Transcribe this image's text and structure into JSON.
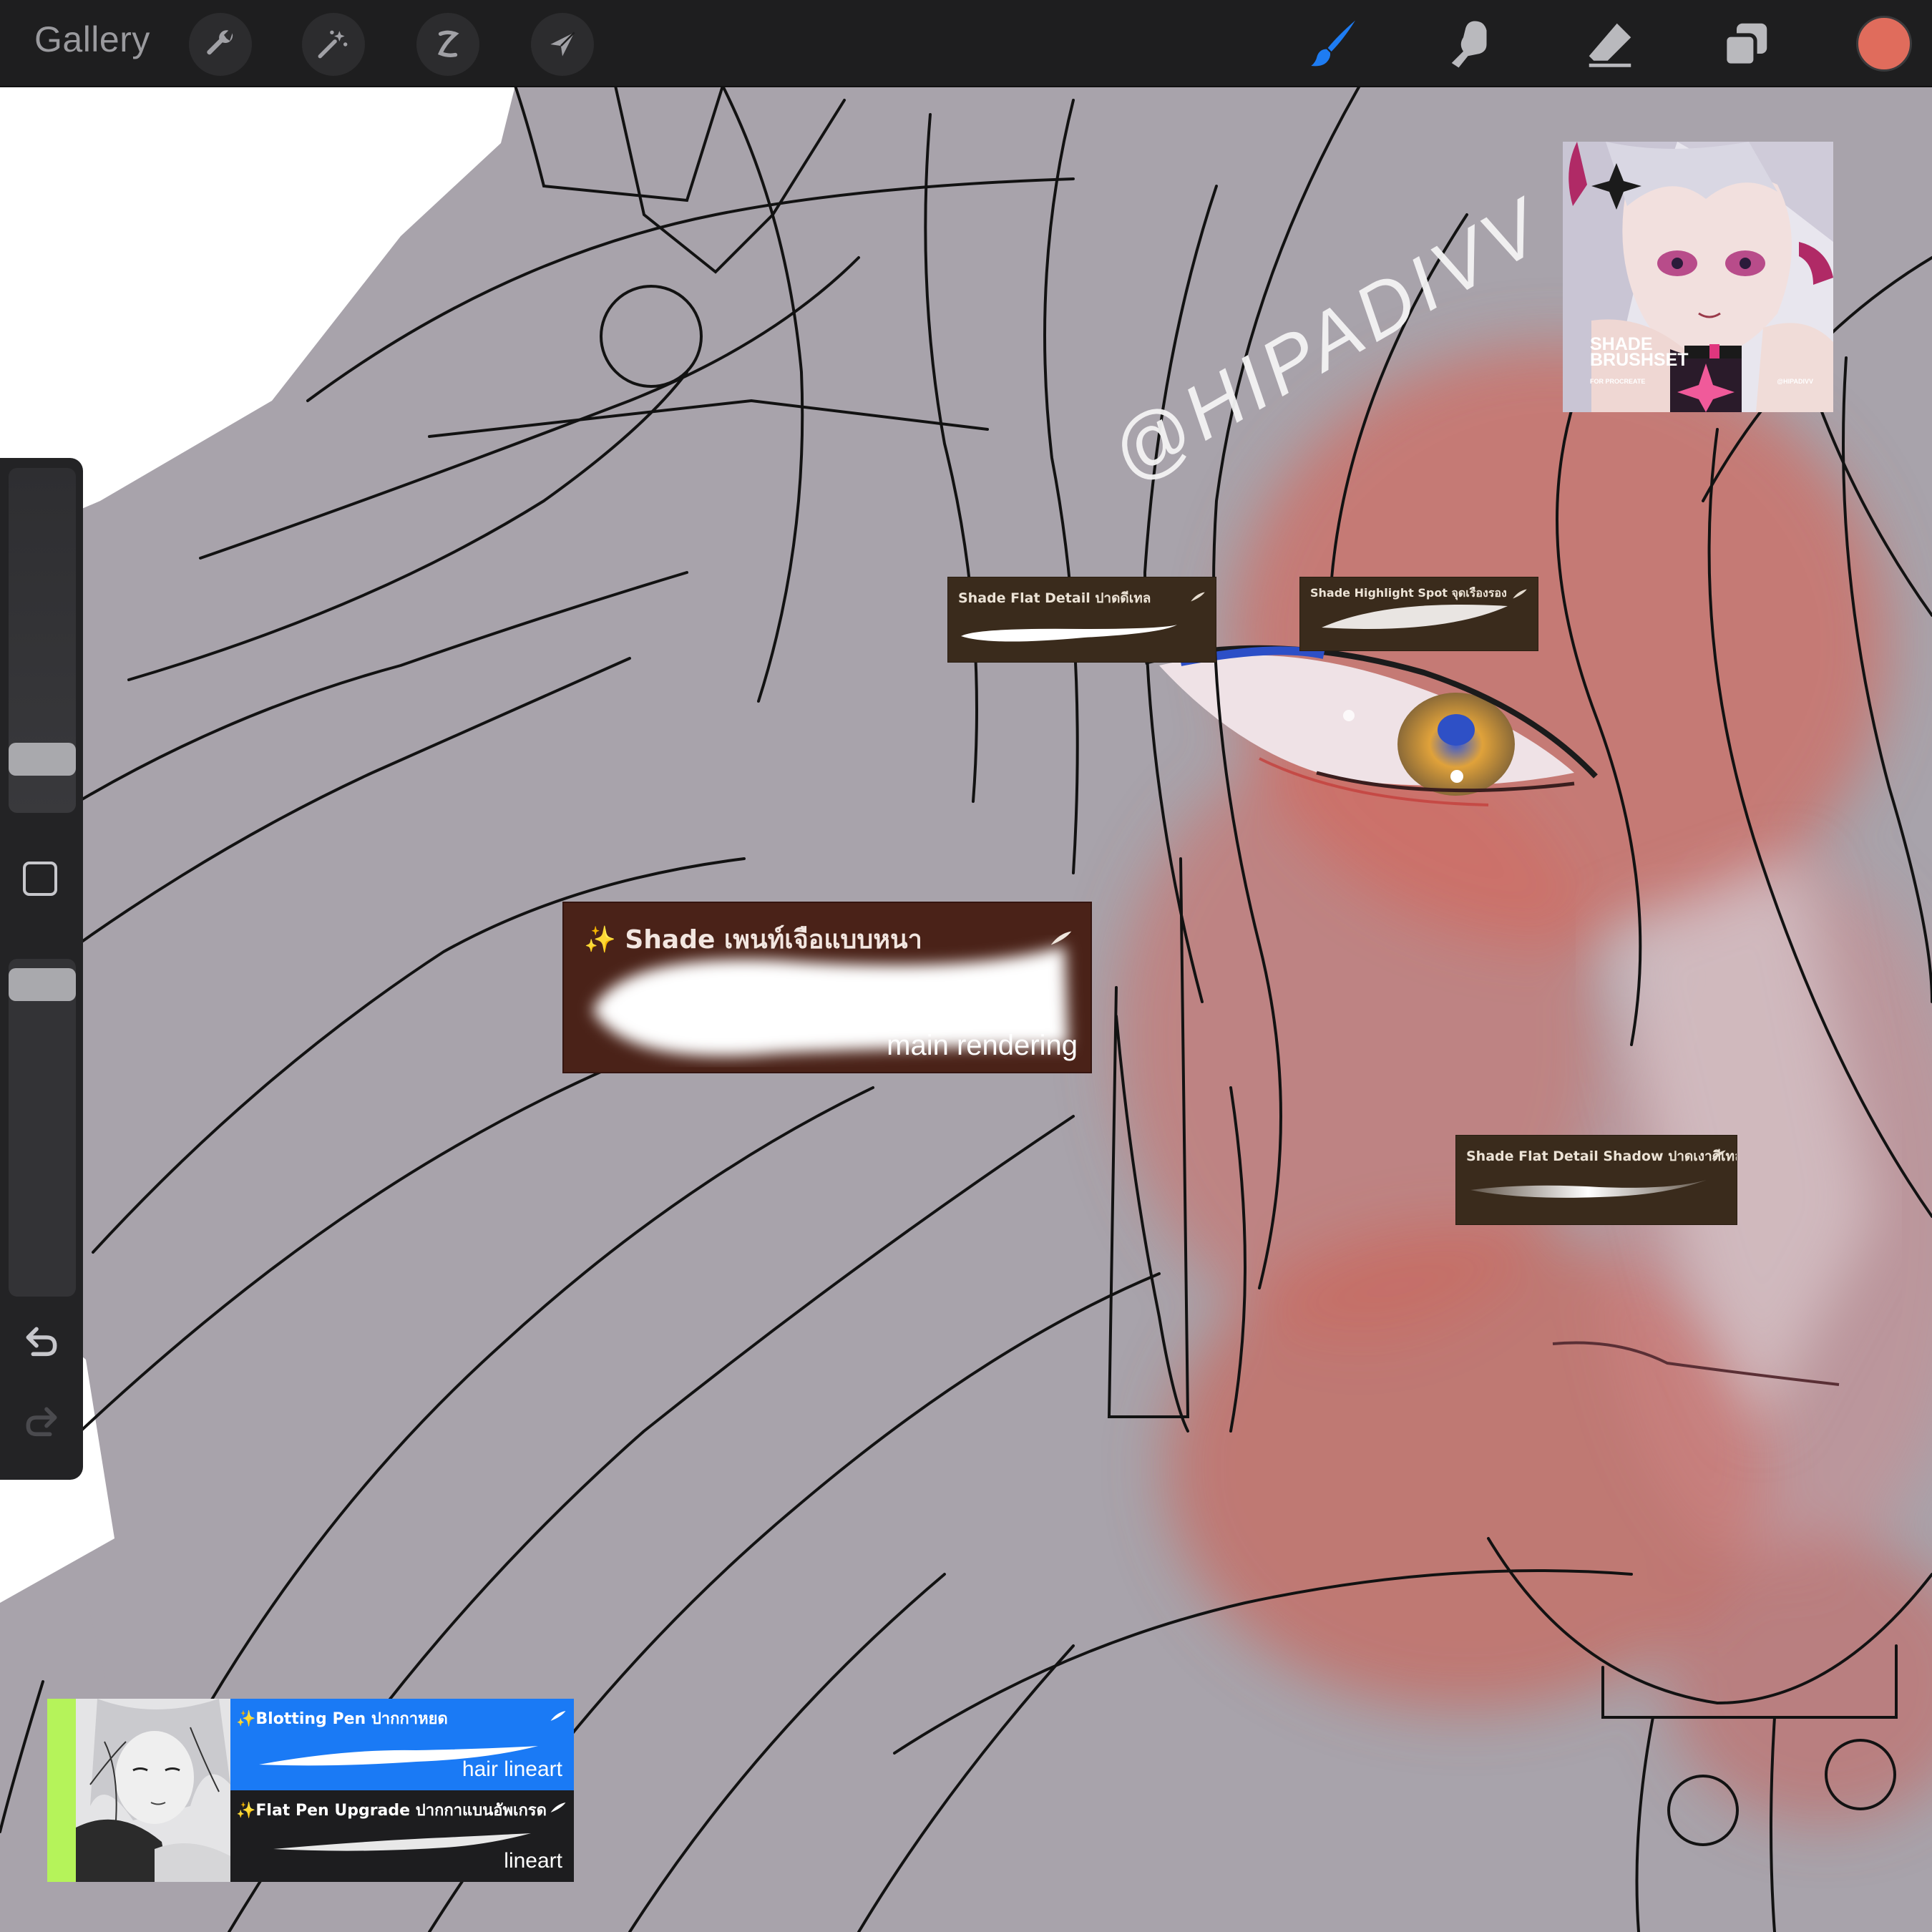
{
  "toolbar": {
    "gallery_label": "Gallery",
    "left_tools": [
      "wrench-icon",
      "magic-wand-icon",
      "selection-icon",
      "transform-icon"
    ],
    "right_tools": [
      "brush-icon",
      "smudge-icon",
      "eraser-icon",
      "layers-icon"
    ],
    "active_tool": "brush-icon",
    "active_color": "#e06c5c",
    "accent_color": "#1e7cf2"
  },
  "sidebar": {
    "brush_size_level": 0.12,
    "brush_opacity_level": 0.97,
    "modify_button_icon": "square-icon",
    "undo_icon": "undo-icon",
    "redo_icon": "redo-icon"
  },
  "watermark": "@HIPADIVV",
  "promo": {
    "title_line1": "SHADE",
    "title_line2": "BRUSHSET",
    "caption_left": "FOR PROCREATE",
    "caption_right": "@HIPADIVV"
  },
  "brushes": [
    {
      "name": "Shade Flat Detail ปาดดีเทล"
    },
    {
      "name": "Shade Highlight Spot จุดเรืองรอง"
    },
    {
      "name": "✨ Shade เพนท์เจือแบบหนา",
      "note": "main rendering"
    },
    {
      "name": "Shade Flat Detail Shadow ปาดเงาดีเทล"
    }
  ],
  "bottom_panel": {
    "rows": [
      {
        "name": "✨Blotting Pen ปากกาหยด",
        "note": "hair lineart",
        "bg": "#1a7af5"
      },
      {
        "name": "✨Flat Pen Upgrade ปากกาแบนอัพเกรด",
        "note": "lineart",
        "bg": "#1d1d1f"
      }
    ],
    "thumb_accent": "#b5f35a"
  }
}
